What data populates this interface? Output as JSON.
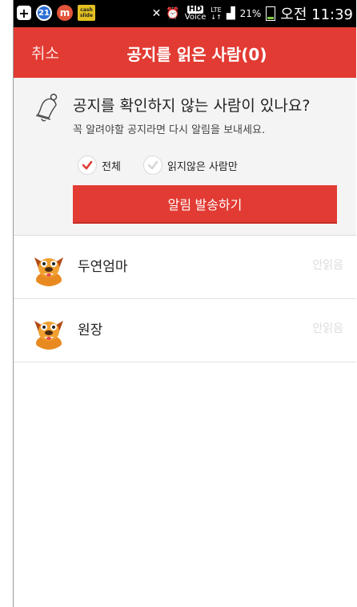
{
  "status_bar": {
    "notif_count": "21",
    "cash_slide": "cash slide",
    "hd": "HD",
    "voice": "Voice",
    "lte": "LTE",
    "battery": "21%",
    "time": "오전 11:39"
  },
  "header": {
    "cancel_label": "취소",
    "title": "공지를 읽은 사람(0)"
  },
  "notice": {
    "question": "공지를 확인하지 않는 사람이 있나요?",
    "subtitle": "꼭 알려야할 공지라면 다시 알림을 보내세요.",
    "filter_all": "전체",
    "filter_unread": "읽지않은 사람만",
    "filter_all_checked": true,
    "filter_unread_checked": false,
    "send_button": "알림 발송하기"
  },
  "members": [
    {
      "name": "두연엄마",
      "status": "안읽음"
    },
    {
      "name": "원장",
      "status": "안읽음"
    }
  ],
  "colors": {
    "accent": "#e23b33",
    "check_active": "#e23b33",
    "check_inactive": "#d6d6d6",
    "status_text": "#dcdcdc"
  }
}
